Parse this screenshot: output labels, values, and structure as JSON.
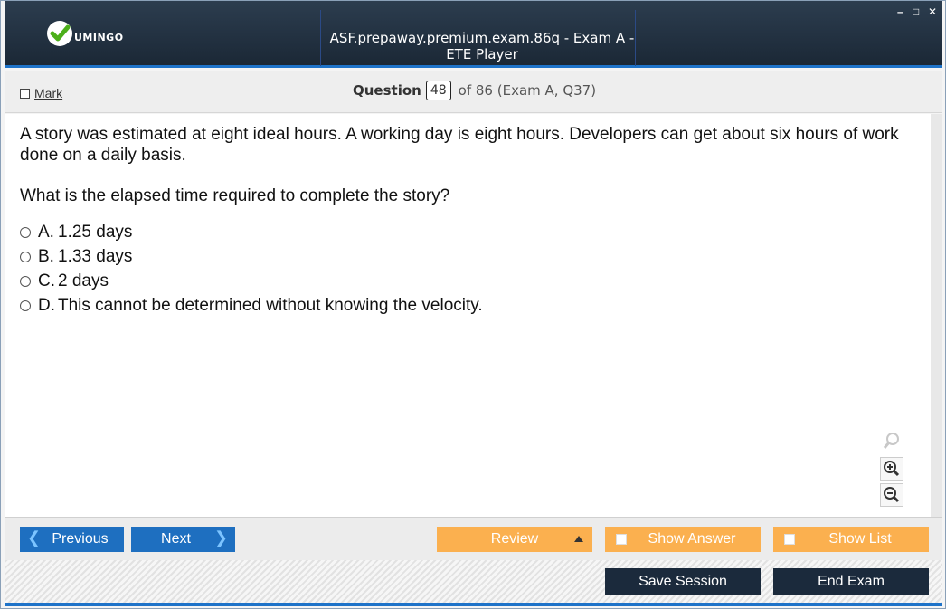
{
  "app": {
    "logo_text": "UMINGO",
    "window_title": "ASF.prepaway.premium.exam.86q - Exam A - ETE Player",
    "controls": {
      "minimize": "–",
      "maximize": "□",
      "close": "✕"
    }
  },
  "header": {
    "mark_label": "Mark",
    "question_label": "Question",
    "question_number": "48",
    "question_of": "of 86 (Exam A, Q37)"
  },
  "question": {
    "text": "A story was estimated at eight ideal hours. A working day is eight hours. Developers can get about six hours of work done on a daily basis.",
    "prompt": "What is the elapsed time required to complete the story?",
    "options": [
      {
        "letter": "A.",
        "text": "1.25 days"
      },
      {
        "letter": "B.",
        "text": "1.33 days"
      },
      {
        "letter": "C.",
        "text": "2 days"
      },
      {
        "letter": "D.",
        "text": "This cannot be determined without knowing the velocity."
      }
    ]
  },
  "zoom": {
    "icons": [
      "zoom-fit-icon",
      "zoom-in-icon",
      "zoom-out-icon"
    ]
  },
  "footer": {
    "previous_label": "Previous",
    "next_label": "Next",
    "review_label": "Review",
    "show_answer_label": "Show Answer",
    "show_list_label": "Show List",
    "save_session_label": "Save Session",
    "end_exam_label": "End Exam"
  },
  "colors": {
    "title_bg": "#1b2836",
    "accent_blue": "#1e6fc0",
    "orange": "#fbb04f",
    "dark_button": "#1b2a3c"
  }
}
